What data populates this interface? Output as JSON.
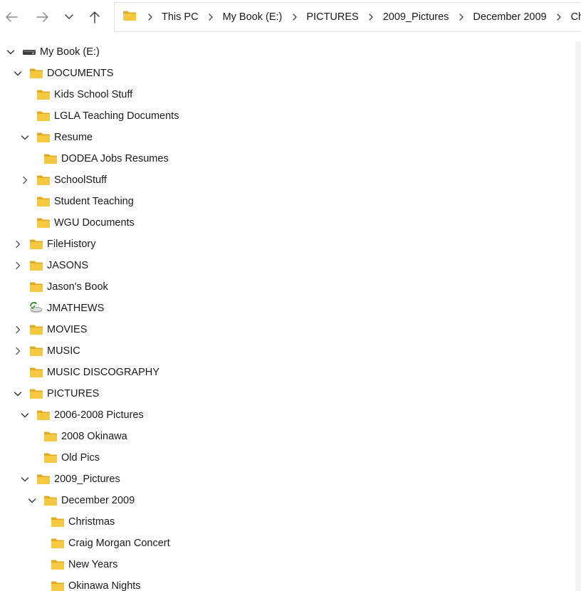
{
  "nav": {
    "back_icon": "back-arrow-icon",
    "forward_icon": "forward-arrow-icon",
    "recent_icon": "chevron-down-icon",
    "up_icon": "up-arrow-icon"
  },
  "address": {
    "folder_icon": "folder-icon",
    "crumbs": [
      "This PC",
      "My Book (E:)",
      "PICTURES",
      "2009_Pictures",
      "December 2009",
      "Christmas"
    ]
  },
  "tree": [
    {
      "label": "My Book (E:)",
      "level": 0,
      "expander": "expanded",
      "icon": "drive-icon"
    },
    {
      "label": "DOCUMENTS",
      "level": 1,
      "expander": "expanded",
      "icon": "folder-icon"
    },
    {
      "label": "Kids School Stuff",
      "level": 2,
      "expander": "none",
      "icon": "folder-icon"
    },
    {
      "label": "LGLA Teaching Documents",
      "level": 2,
      "expander": "none",
      "icon": "folder-icon"
    },
    {
      "label": "Resume",
      "level": 2,
      "expander": "expanded",
      "icon": "folder-icon"
    },
    {
      "label": "DODEA Jobs Resumes",
      "level": 3,
      "expander": "none",
      "icon": "folder-icon"
    },
    {
      "label": "SchoolStuff",
      "level": 2,
      "expander": "collapsed",
      "icon": "folder-icon"
    },
    {
      "label": "Student Teaching",
      "level": 2,
      "expander": "none",
      "icon": "folder-icon"
    },
    {
      "label": "WGU Documents",
      "level": 2,
      "expander": "none",
      "icon": "folder-icon"
    },
    {
      "label": "FileHistory",
      "level": 1,
      "expander": "collapsed",
      "icon": "folder-icon"
    },
    {
      "label": "JASONS",
      "level": 1,
      "expander": "collapsed",
      "icon": "folder-icon"
    },
    {
      "label": "Jason's Book",
      "level": 1,
      "expander": "none",
      "icon": "folder-icon"
    },
    {
      "label": "JMATHEWS",
      "level": 1,
      "expander": "none",
      "icon": "backup-drive-icon"
    },
    {
      "label": "MOVIES",
      "level": 1,
      "expander": "collapsed",
      "icon": "folder-icon"
    },
    {
      "label": "MUSIC",
      "level": 1,
      "expander": "collapsed",
      "icon": "folder-icon"
    },
    {
      "label": "MUSIC DISCOGRAPHY",
      "level": 1,
      "expander": "none",
      "icon": "folder-icon"
    },
    {
      "label": "PICTURES",
      "level": 1,
      "expander": "expanded",
      "icon": "folder-icon"
    },
    {
      "label": "2006-2008 Pictures",
      "level": 2,
      "expander": "expanded",
      "icon": "folder-icon"
    },
    {
      "label": "2008 Okinawa",
      "level": 3,
      "expander": "none",
      "icon": "folder-icon"
    },
    {
      "label": "Old Pics",
      "level": 3,
      "expander": "none",
      "icon": "folder-icon"
    },
    {
      "label": "2009_Pictures",
      "level": 2,
      "expander": "expanded",
      "icon": "folder-icon"
    },
    {
      "label": "December 2009",
      "level": 3,
      "expander": "expanded",
      "icon": "folder-icon"
    },
    {
      "label": "Christmas",
      "level": 4,
      "expander": "none",
      "icon": "folder-icon"
    },
    {
      "label": "Craig Morgan Concert",
      "level": 4,
      "expander": "none",
      "icon": "folder-icon"
    },
    {
      "label": "New Years",
      "level": 4,
      "expander": "none",
      "icon": "folder-icon"
    },
    {
      "label": "Okinawa Nights",
      "level": 4,
      "expander": "none",
      "icon": "folder-icon"
    }
  ],
  "colors": {
    "folder_front": "#f5c842",
    "folder_back": "#e2a922",
    "text": "#1a1a1a",
    "chevron": "#5a5a5a",
    "nav_disabled": "#8c8c8c"
  }
}
